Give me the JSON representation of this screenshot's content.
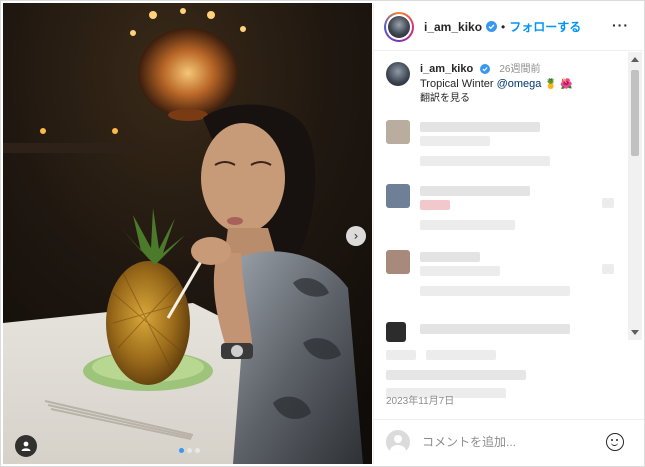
{
  "post": {
    "username": "i_am_kiko",
    "separator": "•",
    "follow_label": "フォローする",
    "more_label": "···",
    "next_label": "›"
  },
  "caption": {
    "username": "i_am_kiko",
    "time_ago": "26週間前",
    "text": "Tropical Winter ",
    "mention": "@omega",
    "emoji": "🍍 🌺",
    "translate_label": "翻訳を見る"
  },
  "date": "2023年11月7日",
  "comment_box": {
    "placeholder": "コメントを追加..."
  },
  "carousel": {
    "count": 3,
    "active_index": 0
  },
  "colors": {
    "link_blue": "#0095f6",
    "verified_blue": "#3897f0",
    "muted_text": "#8e8e8e"
  },
  "icons": [
    "verified-badge-icon",
    "more-options-icon",
    "next-arrow-icon",
    "tag-person-icon",
    "emoji-icon",
    "user-avatar-icon"
  ]
}
